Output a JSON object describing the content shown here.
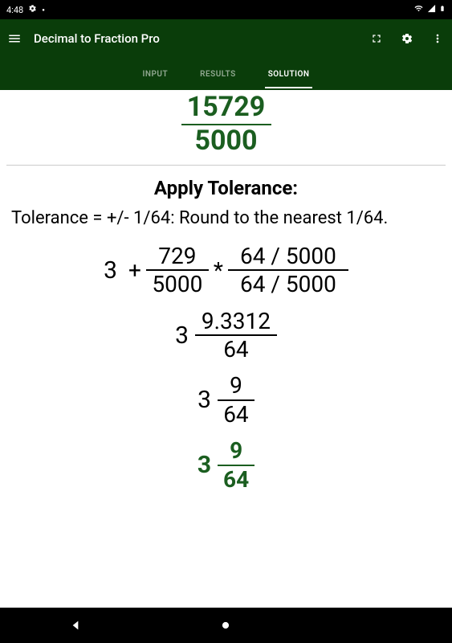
{
  "status": {
    "time": "4:48"
  },
  "app": {
    "title": "Decimal to Fraction Pro"
  },
  "tabs": [
    "INPUT",
    "RESULTS",
    "SOLUTION"
  ],
  "active_tab": 2,
  "big_fraction": {
    "numerator": "15729",
    "denominator": "5000"
  },
  "heading": "Apply Tolerance:",
  "body": "Tolerance = +/- 1/64: Round to the nearest 1/64.",
  "line1": {
    "integer": "3",
    "plus": "+",
    "frac1": {
      "num": "729",
      "den": "5000"
    },
    "star": "*",
    "frac2": {
      "num": "64 / 5000",
      "den": "64 / 5000"
    }
  },
  "line2": {
    "integer": "3",
    "num": "9.3312",
    "den": "64"
  },
  "line3": {
    "integer": "3",
    "num": "9",
    "den": "64"
  },
  "line4": {
    "integer": "3",
    "num": "9",
    "den": "64"
  }
}
